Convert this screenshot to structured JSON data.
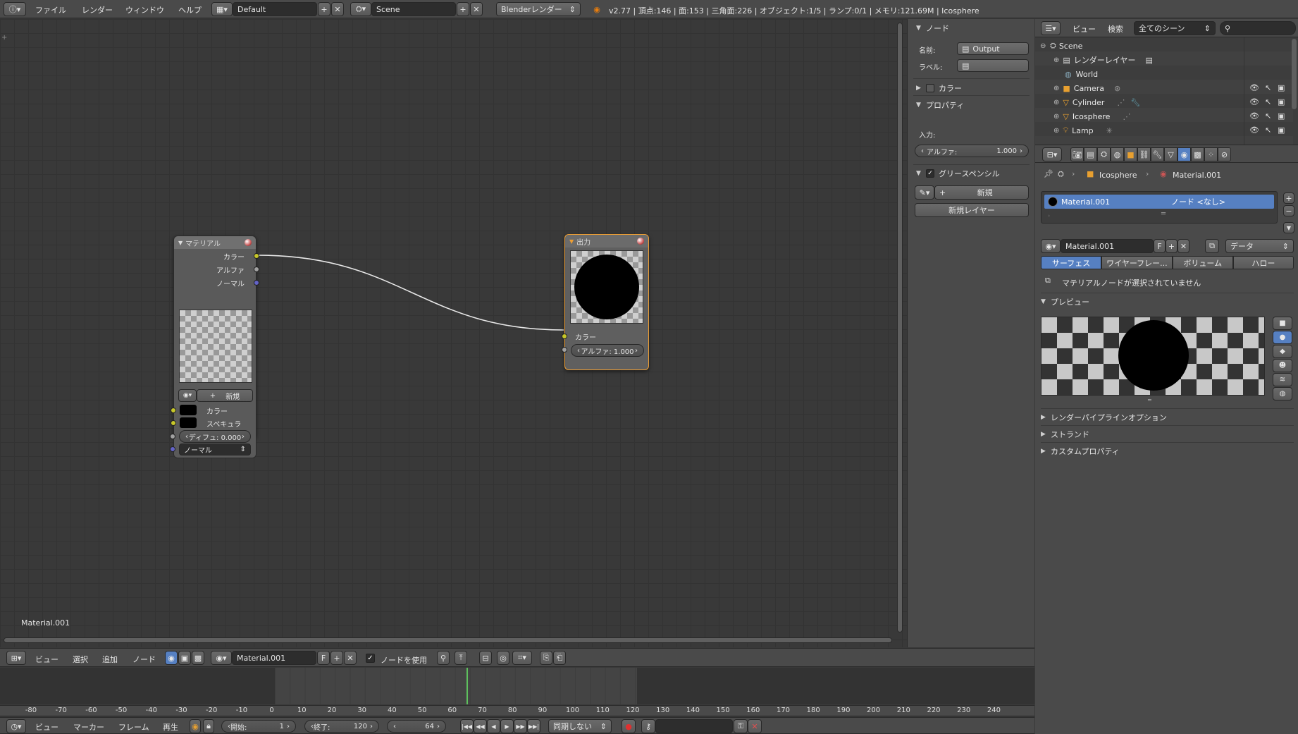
{
  "topbar": {
    "menus": [
      "ファイル",
      "レンダー",
      "ウィンドウ",
      "ヘルプ"
    ],
    "layout": "Default",
    "scene": "Scene",
    "engine": "Blenderレンダー",
    "stats": "v2.77 | 頂点:146 | 面:153 | 三角面:226 | オブジェクト:1/5 | ランプ:0/1 | メモリ:121.69M | Icosphere"
  },
  "node_editor": {
    "material_label": "Material.001",
    "material_node": {
      "title": "マテリアル",
      "outputs": [
        "カラー",
        "アルファ",
        "ノーマル"
      ],
      "new_label": "新規",
      "inputs": [
        "カラー",
        "スペキュラ"
      ],
      "diffuse": "ディフュ: 0.000",
      "normal": "ノーマル"
    },
    "output_node": {
      "title": "出力",
      "input_color": "カラー",
      "alpha": "アルファ: 1.000"
    },
    "header": {
      "menus": [
        "ビュー",
        "選択",
        "追加",
        "ノード"
      ],
      "material": "Material.001",
      "f_label": "F",
      "use_nodes": "ノードを使用"
    }
  },
  "npanel": {
    "node_section": "ノード",
    "name_label": "名前:",
    "name_value": "Output",
    "label_label": "ラベル:",
    "color_section": "カラー",
    "props_section": "プロパティ",
    "input_label": "入力:",
    "alpha_field": "アルファ:",
    "alpha_value": "1.000",
    "gp_section": "グリースペンシル",
    "gp_new": "新規",
    "gp_new_layer": "新規レイヤー"
  },
  "outliner": {
    "menus": [
      "ビュー",
      "検索"
    ],
    "filter": "全てのシーン",
    "items": [
      {
        "name": "Scene",
        "indent": 0
      },
      {
        "name": "レンダーレイヤー",
        "indent": 1
      },
      {
        "name": "World",
        "indent": 1
      },
      {
        "name": "Camera",
        "indent": 1
      },
      {
        "name": "Cylinder",
        "indent": 1
      },
      {
        "name": "Icosphere",
        "indent": 1
      },
      {
        "name": "Lamp",
        "indent": 1
      }
    ]
  },
  "properties": {
    "breadcrumb": [
      "Icosphere",
      "Material.001"
    ],
    "slot_name": "Material.001",
    "slot_node": "ノード <なし>",
    "material_name": "Material.001",
    "f_label": "F",
    "data_dropdown": "データ",
    "tabs": [
      "サーフェス",
      "ワイヤーフレー...",
      "ボリューム",
      "ハロー"
    ],
    "no_node": "マテリアルノードが選択されていません",
    "preview": "プレビュー",
    "sections": [
      "レンダーパイプラインオプション",
      "ストランド",
      "カスタムプロパティ"
    ]
  },
  "timeline": {
    "ticks": [
      "-80",
      "-70",
      "-60",
      "-50",
      "-40",
      "-30",
      "-20",
      "-10",
      "0",
      "10",
      "20",
      "30",
      "40",
      "50",
      "60",
      "70",
      "80",
      "90",
      "100",
      "110",
      "120",
      "130",
      "140",
      "150",
      "160",
      "170",
      "180",
      "190",
      "200",
      "210",
      "220",
      "230",
      "240"
    ],
    "menus": [
      "ビュー",
      "マーカー",
      "フレーム",
      "再生"
    ],
    "start": "開始:",
    "start_val": "1",
    "end": "終了:",
    "end_val": "120",
    "current": "64",
    "sync": "同期しない"
  },
  "colors": {
    "accent": "#5680c2",
    "socket_yellow": "#c7c729",
    "socket_gray": "#a1a1a1",
    "socket_blue": "#6363c7",
    "frame_green": "#5ec05e",
    "output_border": "#ed9e34"
  }
}
